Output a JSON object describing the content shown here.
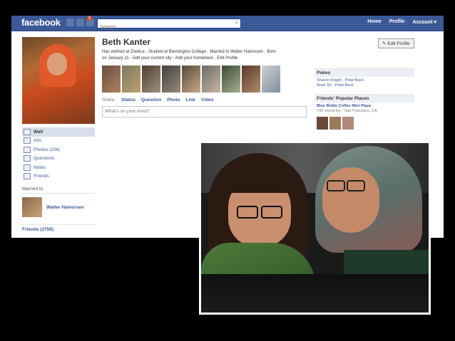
{
  "header": {
    "logo": "facebook",
    "notification_count": "1",
    "search_placeholder": "Search",
    "nav": [
      "Home",
      "Profile",
      "Account ▾"
    ]
  },
  "profile": {
    "name": "Beth Kanter",
    "edit_button": "Edit Profile",
    "info_line1": "Has worked at Zoetica · Studied at Bennington College · Married to Walter Halvorsen · Born",
    "info_line2": "on January 11 · Add your current city · Add your hometown · Edit Profile"
  },
  "sidebar": {
    "items": [
      "Wall",
      "Info",
      "Photos (204)",
      "Questions",
      "Notes",
      "Friends"
    ],
    "married_label": "Married to",
    "married_name": "Walter Halvorsen",
    "friends_label": "Friends (2756)"
  },
  "share": {
    "label": "Share:",
    "options": [
      "Status",
      "Question",
      "Photo",
      "Link",
      "Video"
    ],
    "placeholder": "What's on your mind?"
  },
  "pokes": {
    "title": "Pokes",
    "line1": "Sharon Knight · Poke Back",
    "line2": "Anas Sh · Poke Back"
  },
  "places": {
    "title": "Friends' Popular Places",
    "name": "Blue Bottle Coffee Mint Plaza",
    "detail": "730 check-ins · San Francisco, CA"
  }
}
